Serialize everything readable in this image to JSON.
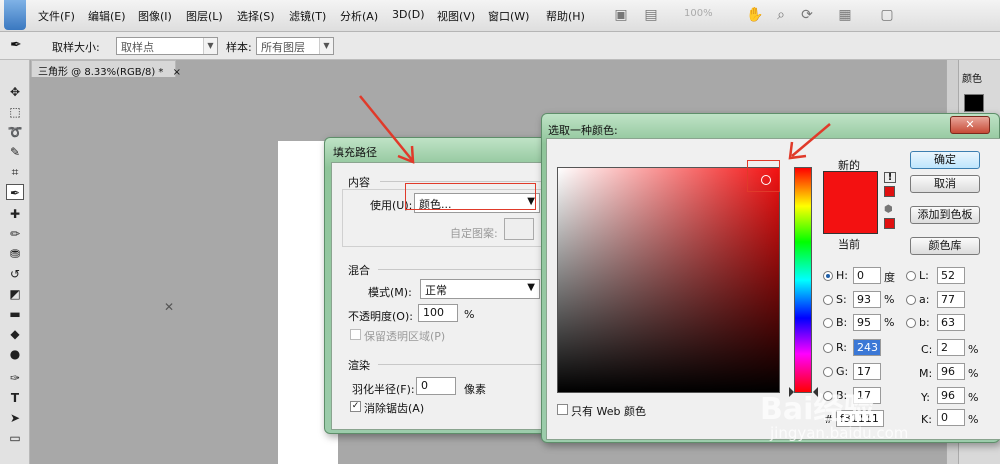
{
  "menubar": {
    "items": [
      "文件(F)",
      "编辑(E)",
      "图像(I)",
      "图层(L)",
      "选择(S)",
      "滤镜(T)",
      "分析(A)",
      "3D(D)",
      "视图(V)",
      "窗口(W)",
      "帮助(H)"
    ],
    "zoom": "100%"
  },
  "options": {
    "sample_size_label": "取样大小:",
    "sample_size_value": "取样点",
    "sample_label": "样本:",
    "sample_value": "所有图层"
  },
  "document": {
    "tab_title": "三角形 @ 8.33%(RGB/8) *",
    "tab_close": "×"
  },
  "right_panel": {
    "tab": "颜色"
  },
  "fill_path_dialog": {
    "title": "填充路径",
    "content_group": "内容",
    "use_label": "使用(U):",
    "use_value": "颜色...",
    "custom_pattern_label": "自定图案:",
    "blend_group": "混合",
    "mode_label": "模式(M):",
    "mode_value": "正常",
    "opacity_label": "不透明度(O):",
    "opacity_value": "100",
    "opacity_unit": "%",
    "preserve_transparency": "保留透明区域(P)",
    "render_group": "渲染",
    "feather_label": "羽化半径(F):",
    "feather_value": "0",
    "feather_unit": "像素",
    "antialias_label": "消除锯齿(A)",
    "antialias_checked": "✓"
  },
  "color_picker": {
    "title": "选取一种颜色:",
    "close": "✕",
    "new_label": "新的",
    "current_label": "当前",
    "new_color": "#f31111",
    "current_color": "#f31111",
    "buttons": {
      "ok": "确定",
      "cancel": "取消",
      "add_swatch": "添加到色板",
      "libraries": "颜色库"
    },
    "hsb": [
      {
        "label": "H:",
        "value": "0",
        "unit": "度",
        "selected": true
      },
      {
        "label": "S:",
        "value": "93",
        "unit": "%",
        "selected": false
      },
      {
        "label": "B:",
        "value": "95",
        "unit": "%",
        "selected": false
      }
    ],
    "lab": [
      {
        "label": "L:",
        "value": "52"
      },
      {
        "label": "a:",
        "value": "77"
      },
      {
        "label": "b:",
        "value": "63"
      }
    ],
    "rgb": [
      {
        "label": "R:",
        "value": "243"
      },
      {
        "label": "G:",
        "value": "17"
      },
      {
        "label": "B:",
        "value": "17"
      }
    ],
    "cmyk": [
      {
        "label": "C:",
        "value": "2",
        "unit": "%"
      },
      {
        "label": "M:",
        "value": "96",
        "unit": "%"
      },
      {
        "label": "Y:",
        "value": "96",
        "unit": "%"
      },
      {
        "label": "K:",
        "value": "0",
        "unit": "%"
      }
    ],
    "hex_label": "#",
    "hex_value": "f31111",
    "web_only_label": "只有 Web 颜色",
    "warning_glyph": "!",
    "cube_glyph": "⬢"
  },
  "watermark": {
    "brand": "Bai经验",
    "url": "jingyan.baidu.com"
  },
  "colors": {
    "accent_red": "#e03a2a",
    "selected_color": "#f31111"
  }
}
